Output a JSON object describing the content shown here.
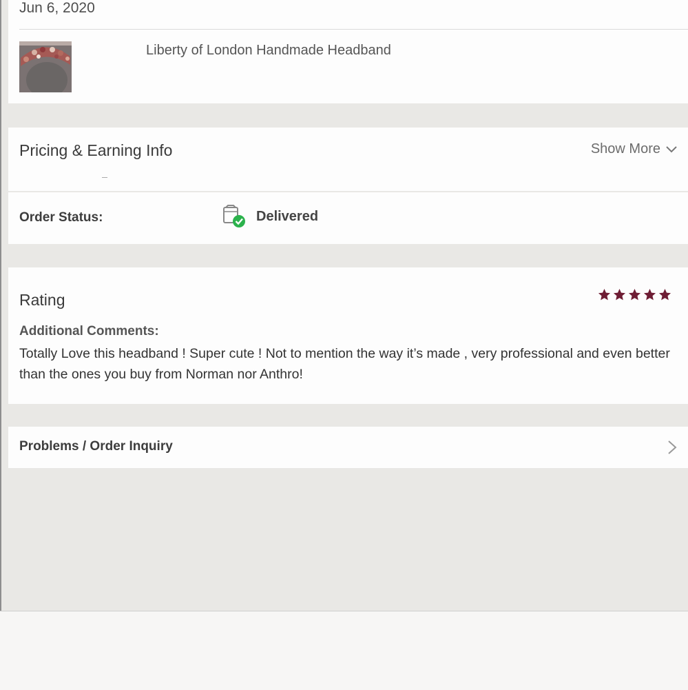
{
  "order": {
    "date": "Jun 6, 2020",
    "item_title": "Liberty of London Handmade Headband",
    "thumbnail_icon": "headband-photo"
  },
  "pricing": {
    "title": "Pricing & Earning Info",
    "show_more_label": "Show More",
    "show_more_icon": "chevron-down-icon"
  },
  "status": {
    "label": "Order Status:",
    "value": "Delivered",
    "icon": "delivered-box-check-icon",
    "check_color": "#2bb24c"
  },
  "rating": {
    "title": "Rating",
    "stars": 5,
    "max_stars": 5,
    "star_color": "#6e1d34",
    "comments_label": "Additional Comments:",
    "comments_text": "Totally Love this headband ! Super cute ! Not to mention the way it’s made , very professional and even better than the ones you buy from Norman nor Anthro!"
  },
  "problems": {
    "label": "Problems / Order Inquiry",
    "icon": "chevron-right-icon"
  }
}
